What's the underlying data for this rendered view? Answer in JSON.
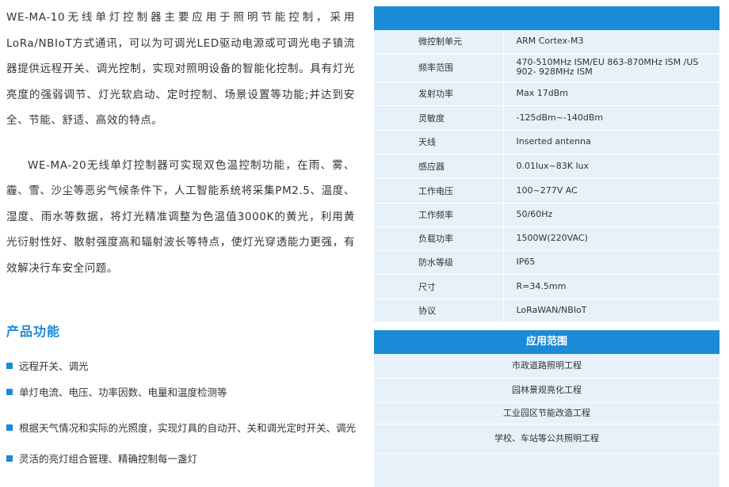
{
  "intro": {
    "paragraph1": "WE-MA-10无线单灯控制器主要应用于照明节能控制，采用LoRa/NBIoT方式通讯，可以为可调光LED驱动电源或可调光电子镇流器提供远程开关、调光控制，实现对照明设备的智能化控制。具有灯光亮度的强弱调节、灯光软启动、定时控制、场景设置等功能;并达到安全、节能、舒适、高效的特点。",
    "paragraph2": "WE-MA-20无线单灯控制器可实现双色温控制功能，在雨、雾、霾、雪、沙尘等恶劣气候条件下，人工智能系统将采集PM2.5、温度、湿度、雨水等数据，将灯光精准调整为色温值3000K的黄光，利用黄光衍射性好、散射强度高和辐射波长等特点，使灯光穿透能力更强，有效解决行车安全问题。"
  },
  "features": {
    "title": "产品功能",
    "items": [
      "远程开关、调光",
      "单灯电流、电压、功率因数、电量和温度检测等",
      "根据天气情况和实际的光照度，实现灯具的自动开、关和调光定时开关、调光",
      "灵活的亮灯组合管理、精确控制每一盏灯"
    ]
  },
  "specs": {
    "rows": [
      {
        "key": "微控制单元",
        "value": "ARM Cortex-M3"
      },
      {
        "key": "频率范围",
        "value": "470-510MHz ISM/EU 863-870MHz ISM /US 902- 928MHz ISM"
      },
      {
        "key": "发射功率",
        "value": "Max 17dBm"
      },
      {
        "key": "灵敏度",
        "value": "-125dBm~-140dBm"
      },
      {
        "key": "天线",
        "value": "Inserted antenna"
      },
      {
        "key": "感应器",
        "value": "0.01lux~83K lux"
      },
      {
        "key": "工作电压",
        "value": "100~277V AC"
      },
      {
        "key": "工作频率",
        "value": "50/60Hz"
      },
      {
        "key": "负载功率",
        "value": "1500W(220VAC)"
      },
      {
        "key": "防水等级",
        "value": "IP65"
      },
      {
        "key": "尺寸",
        "value": "R=34.5mm"
      },
      {
        "key": "协议",
        "value": "LoRaWAN/NBIoT"
      }
    ]
  },
  "applications": {
    "title": "应用范围",
    "items": [
      "市政道路照明工程",
      "园林景观亮化工程",
      "工业园区节能改造工程",
      "学校、车站等公共照明工程"
    ]
  },
  "colors": {
    "accent": "#1a8bd6",
    "row_bg": "#e6f1fa"
  }
}
